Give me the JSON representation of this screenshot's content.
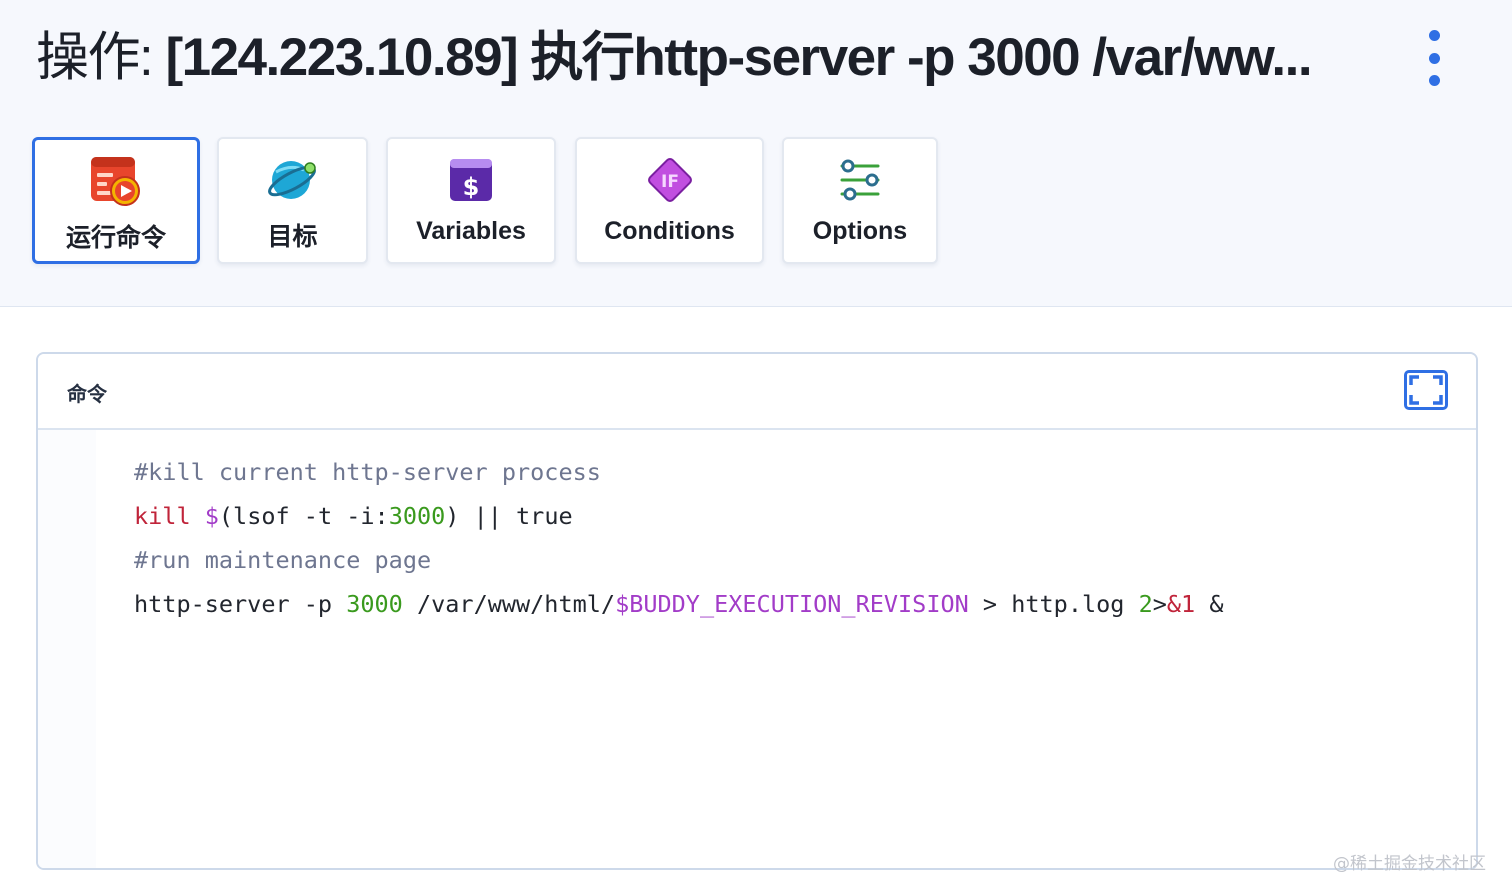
{
  "header": {
    "title_prefix": "操作: ",
    "title_main": "[124.223.10.89] 执行http-server -p 3000 /var/ww..."
  },
  "tabs": [
    {
      "label": "运行命令",
      "icon": "run-command-icon",
      "active": true
    },
    {
      "label": "目标",
      "icon": "planet-target-icon",
      "active": false
    },
    {
      "label": "Variables",
      "icon": "dollar-variables-icon",
      "active": false
    },
    {
      "label": "Conditions",
      "icon": "if-diamond-icon",
      "active": false
    },
    {
      "label": "Options",
      "icon": "sliders-options-icon",
      "active": false
    }
  ],
  "panel": {
    "title": "命令",
    "code": {
      "line1": "#kill current http-server process",
      "line2": {
        "kw": "kill",
        "dollar": "$",
        "open": "(lsof -t -i:",
        "port": "3000",
        "close": ") || true"
      },
      "line3": "#run maintenance page",
      "line4": {
        "cmd": "http-server -p ",
        "port": "3000",
        "path": " /var/www/html/",
        "var": "$BUDDY_EXECUTION_REVISION",
        "redir": " > http.log ",
        "two": "2",
        "gt": ">",
        "amp1": "&1",
        "tail": " &"
      }
    }
  },
  "watermark": "@稀土掘金技术社区",
  "colors": {
    "accent": "#2f6fe4",
    "keyword": "#c0243a",
    "variable": "#a23cc8",
    "number": "#3a9a1e",
    "comment": "#6e7690"
  }
}
